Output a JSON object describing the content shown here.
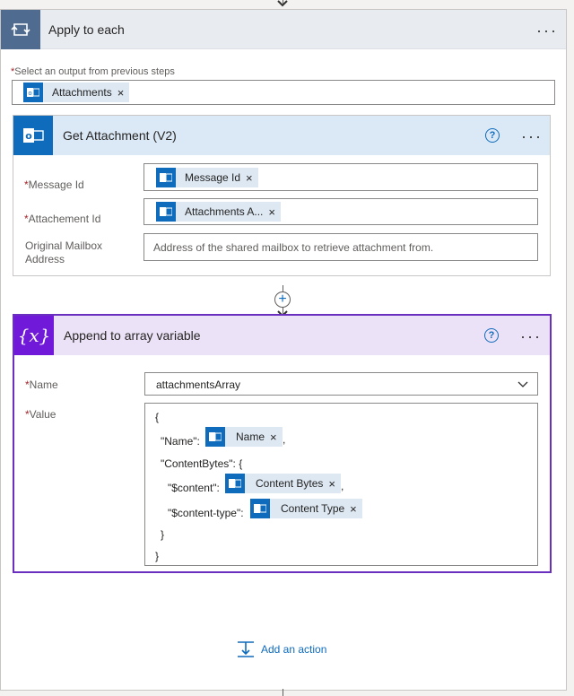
{
  "apply_to_each": {
    "title": "Apply to each",
    "more": "···",
    "select_label": "Select an output from previous steps",
    "required_mark": "*",
    "token_label": "Attachments",
    "close": "×"
  },
  "get_attachment": {
    "title": "Get Attachment (V2)",
    "help": "?",
    "more": "···",
    "fields": {
      "message_id_label": "Message Id",
      "message_id_token": "Message Id",
      "attachment_id_label": "Attachement Id",
      "attachment_id_token": "Attachments A...",
      "mailbox_label_1": "Original Mailbox",
      "mailbox_label_2": "Address",
      "mailbox_placeholder": "Address of the shared mailbox to retrieve attachment from."
    }
  },
  "append": {
    "title": "Append to array variable",
    "icon_text": "{x}",
    "help": "?",
    "more": "···",
    "name_label": "Name",
    "name_value": "attachmentsArray",
    "value_label": "Value",
    "code": {
      "open_brace": "{",
      "name_key": "\"Name\":",
      "name_token": "Name",
      "comma": ",",
      "content_bytes_key": "\"ContentBytes\": {",
      "content_key": "\"$content\":",
      "content_token": "Content Bytes",
      "content_type_key": "\"$content-type\":",
      "content_type_token": "Content Type",
      "inner_close": "}",
      "outer_close": "}"
    }
  },
  "add_action": {
    "label": "Add an action"
  },
  "colors": {
    "outlook_blue": "#0f6cbd",
    "variable_purple": "#7019d8",
    "loop_slate": "#4f6b8f"
  }
}
